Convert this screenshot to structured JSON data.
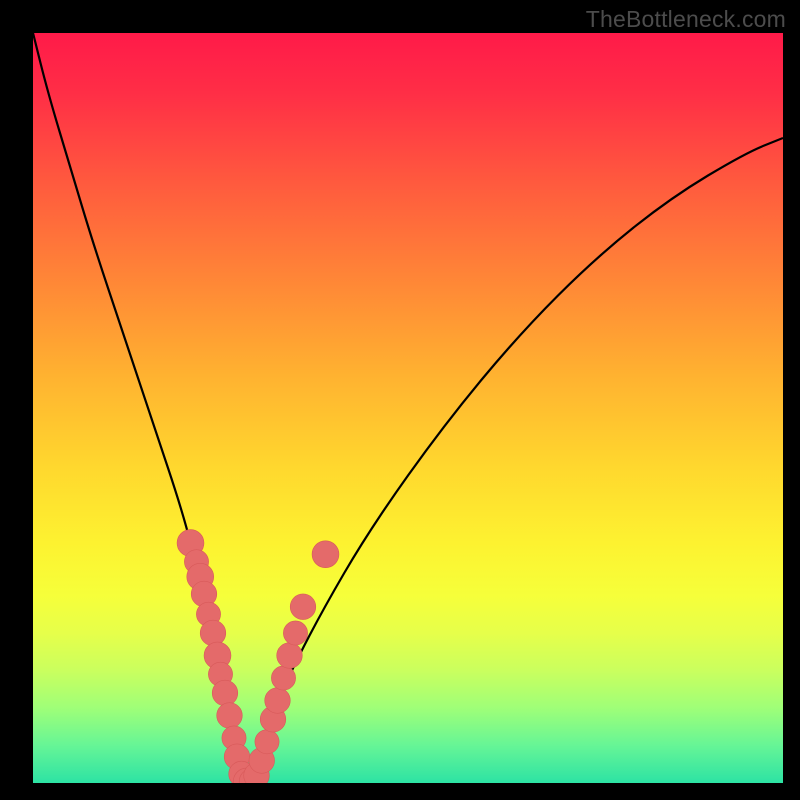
{
  "watermark": {
    "text": "TheBottleneck.com"
  },
  "colors": {
    "frame": "#000000",
    "curve_stroke": "#000000",
    "dot_fill": "#e46a6a",
    "dot_stroke": "#d85a5a",
    "gradient_stops": [
      "#ff1a49",
      "#ff2e46",
      "#ff5a3e",
      "#ff8a36",
      "#ffb330",
      "#ffd82e",
      "#fdf230",
      "#f6ff3a",
      "#e6ff4a",
      "#caff5e",
      "#9fff78",
      "#66f596",
      "#2de3a4"
    ]
  },
  "chart_data": {
    "type": "line",
    "title": "",
    "xlabel": "",
    "ylabel": "",
    "xlim": [
      0,
      100
    ],
    "ylim": [
      0,
      100
    ],
    "grid": false,
    "legend": false,
    "series": [
      {
        "name": "bottleneck-curve",
        "x": [
          0,
          2,
          5,
          8,
          12,
          16,
          20,
          22,
          24,
          25.5,
          27,
          28.5,
          30,
          33,
          38,
          45,
          55,
          65,
          75,
          85,
          95,
          100
        ],
        "y": [
          100,
          92,
          82,
          72,
          60,
          48,
          36,
          28,
          20,
          12,
          4,
          0,
          4,
          12,
          22,
          34,
          48,
          60,
          70,
          78,
          84,
          86
        ]
      }
    ],
    "annotations": {
      "dots": {
        "name": "highlighted-points",
        "points": [
          {
            "x": 21.0,
            "y": 32.0,
            "r": 1.4
          },
          {
            "x": 21.8,
            "y": 29.5,
            "r": 1.2
          },
          {
            "x": 22.3,
            "y": 27.5,
            "r": 1.4
          },
          {
            "x": 22.8,
            "y": 25.2,
            "r": 1.3
          },
          {
            "x": 23.4,
            "y": 22.5,
            "r": 1.2
          },
          {
            "x": 24.0,
            "y": 20.0,
            "r": 1.3
          },
          {
            "x": 24.6,
            "y": 17.0,
            "r": 1.4
          },
          {
            "x": 25.0,
            "y": 14.5,
            "r": 1.2
          },
          {
            "x": 25.6,
            "y": 12.0,
            "r": 1.3
          },
          {
            "x": 26.2,
            "y": 9.0,
            "r": 1.3
          },
          {
            "x": 26.8,
            "y": 6.0,
            "r": 1.2
          },
          {
            "x": 27.2,
            "y": 3.5,
            "r": 1.3
          },
          {
            "x": 27.8,
            "y": 1.2,
            "r": 1.3
          },
          {
            "x": 28.5,
            "y": 0.2,
            "r": 1.4
          },
          {
            "x": 29.2,
            "y": 0.2,
            "r": 1.3
          },
          {
            "x": 29.8,
            "y": 1.0,
            "r": 1.3
          },
          {
            "x": 30.5,
            "y": 3.0,
            "r": 1.3
          },
          {
            "x": 31.2,
            "y": 5.5,
            "r": 1.2
          },
          {
            "x": 32.0,
            "y": 8.5,
            "r": 1.3
          },
          {
            "x": 32.6,
            "y": 11.0,
            "r": 1.3
          },
          {
            "x": 33.4,
            "y": 14.0,
            "r": 1.2
          },
          {
            "x": 34.2,
            "y": 17.0,
            "r": 1.3
          },
          {
            "x": 35.0,
            "y": 20.0,
            "r": 1.2
          },
          {
            "x": 36.0,
            "y": 23.5,
            "r": 1.3
          },
          {
            "x": 39.0,
            "y": 30.5,
            "r": 1.4
          }
        ]
      }
    }
  }
}
